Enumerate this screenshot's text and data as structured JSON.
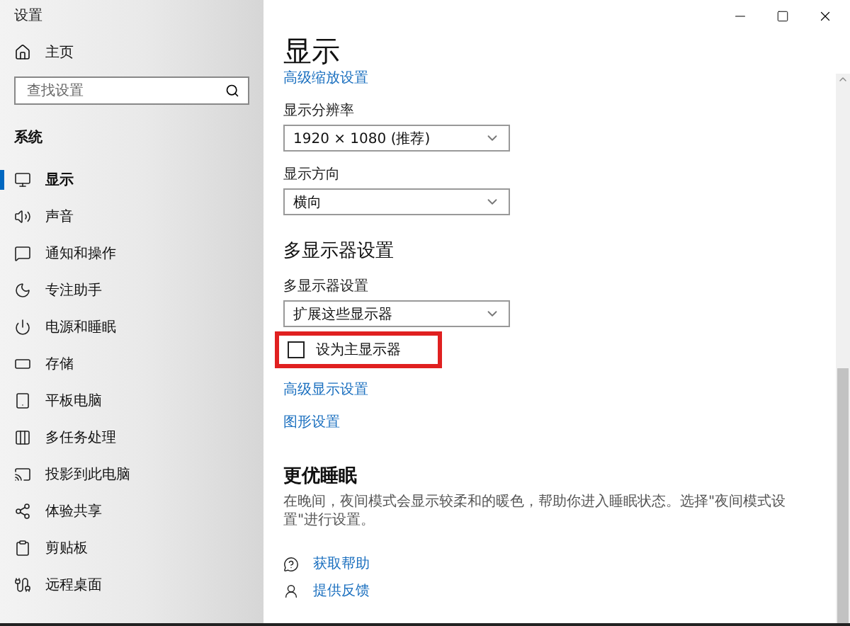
{
  "window": {
    "title": "设置"
  },
  "sidebar": {
    "home": "主页",
    "search": {
      "placeholder": "查找设置"
    },
    "section": "系统",
    "items": [
      {
        "label": "显示",
        "selected": true
      },
      {
        "label": "声音",
        "selected": false
      },
      {
        "label": "通知和操作",
        "selected": false
      },
      {
        "label": "专注助手",
        "selected": false
      },
      {
        "label": "电源和睡眠",
        "selected": false
      },
      {
        "label": "存储",
        "selected": false
      },
      {
        "label": "平板电脑",
        "selected": false
      },
      {
        "label": "多任务处理",
        "selected": false
      },
      {
        "label": "投影到此电脑",
        "selected": false
      },
      {
        "label": "体验共享",
        "selected": false
      },
      {
        "label": "剪贴板",
        "selected": false
      },
      {
        "label": "远程桌面",
        "selected": false
      }
    ]
  },
  "page": {
    "title": "显示",
    "top_link": "高级缩放设置",
    "fields": [
      {
        "label": "显示分辨率",
        "value": "1920 × 1080 (推荐)"
      },
      {
        "label": "显示方向",
        "value": "横向"
      }
    ],
    "multi": {
      "heading": "多显示器设置",
      "label": "多显示器设置",
      "value": "扩展这些显示器",
      "checkbox": {
        "label": "设为主显示器",
        "checked": false,
        "highlighted": true
      },
      "links": [
        "高级显示设置",
        "图形设置"
      ]
    },
    "sleep": {
      "heading": "更优睡眠",
      "text": "在晚间，夜间模式会显示较柔和的暖色，帮助你进入睡眠状态。选择\"夜间模式设置\"进行设置。"
    },
    "help": [
      "获取帮助",
      "提供反馈"
    ]
  }
}
